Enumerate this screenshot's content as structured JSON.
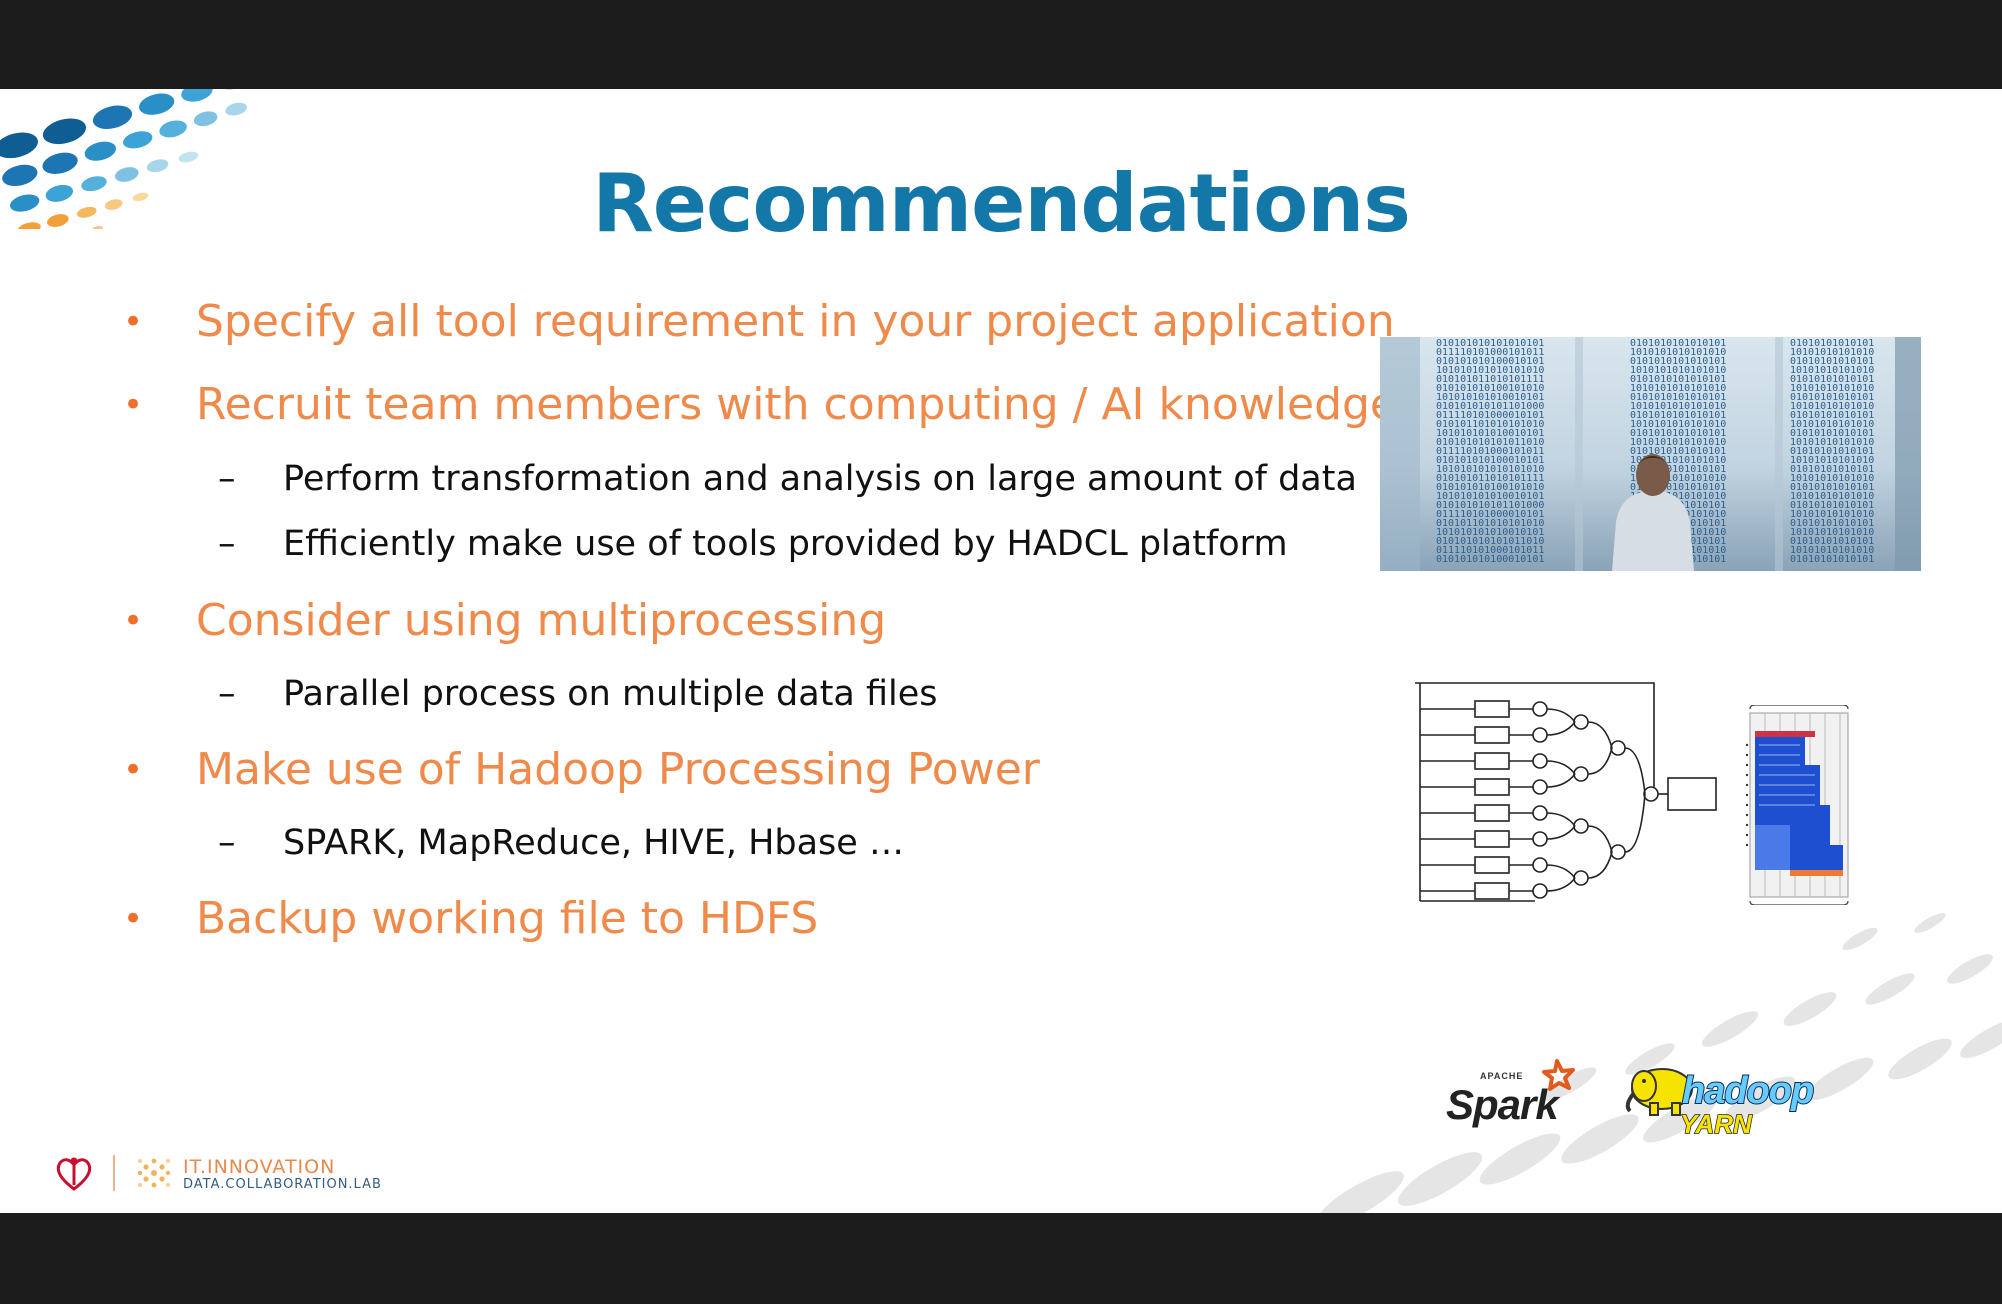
{
  "slide": {
    "title": "Recommendations",
    "bullets": [
      {
        "text": "Specify all tool requirement in your project application"
      },
      {
        "text": "Recruit team members with computing / AI knowledge"
      },
      {
        "text": "Consider using multiprocessing"
      },
      {
        "text": "Make use of Hadoop Processing Power"
      },
      {
        "text": "Backup working file to HDFS"
      }
    ],
    "subs": [
      {
        "text": "Perform transformation and analysis on large amount of data"
      },
      {
        "text": "Efficiently make use of tools provided by HADCL platform"
      },
      {
        "text": "Parallel process on multiple data files"
      },
      {
        "text": "SPARK, MapReduce, HIVE, Hbase …"
      }
    ],
    "bullet_glyph": "•",
    "dash_glyph": "–"
  },
  "logos": {
    "spark_small": "APACHE",
    "spark": "Spark",
    "hadoop": "hadoop",
    "yarn": "YARN"
  },
  "footer": {
    "brand_line1": "IT.INNOVATION",
    "brand_line2": "DATA.COLLABORATION.LAB"
  },
  "colors": {
    "title": "#1377a8",
    "bullet": "#ef8a4a",
    "sub": "#111111",
    "accent": "#ef6f2a"
  },
  "icons": {
    "org_logo": "heart-person-icon",
    "lab_logo": "dot-swirl-icon"
  }
}
